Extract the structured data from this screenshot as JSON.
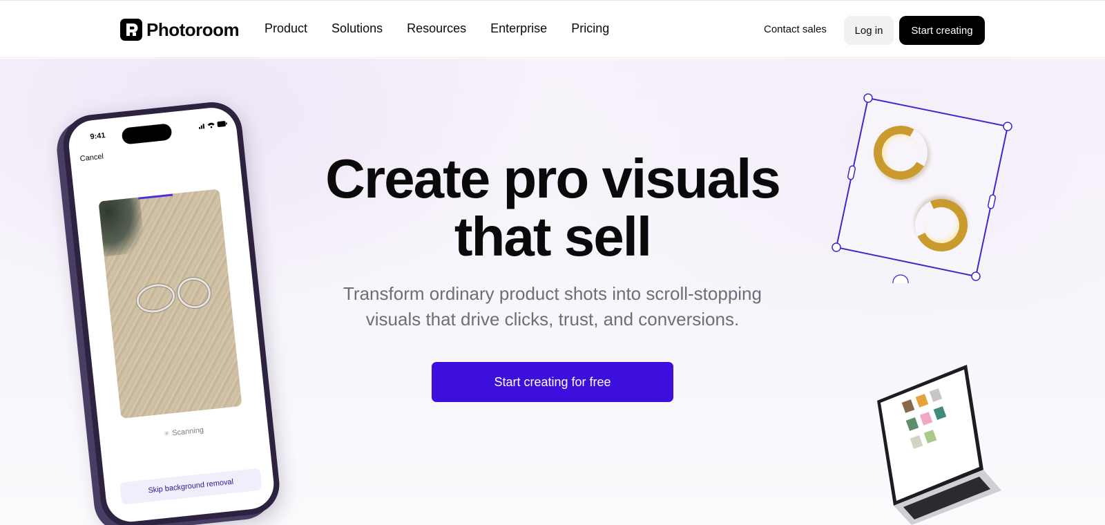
{
  "header": {
    "logo_text": "Photoroom",
    "nav": [
      {
        "label": "Product"
      },
      {
        "label": "Solutions"
      },
      {
        "label": "Resources"
      },
      {
        "label": "Enterprise"
      },
      {
        "label": "Pricing"
      }
    ],
    "contact_label": "Contact sales",
    "login_label": "Log in",
    "start_label": "Start creating"
  },
  "hero": {
    "headline_line1": "Create pro visuals",
    "headline_line2": "that sell",
    "sub_line1": "Transform ordinary product shots into scroll-stopping",
    "sub_line2": "visuals that drive clicks, trust, and conversions.",
    "cta_label": "Start creating for free"
  },
  "phone": {
    "time": "9:41",
    "cancel_label": "Cancel",
    "scanning_label": "Scanning",
    "skip_label": "Skip background removal"
  },
  "colors": {
    "accent": "#3c0fdc",
    "selection_outline": "#3d27c7",
    "gold": "#c99a2e"
  }
}
